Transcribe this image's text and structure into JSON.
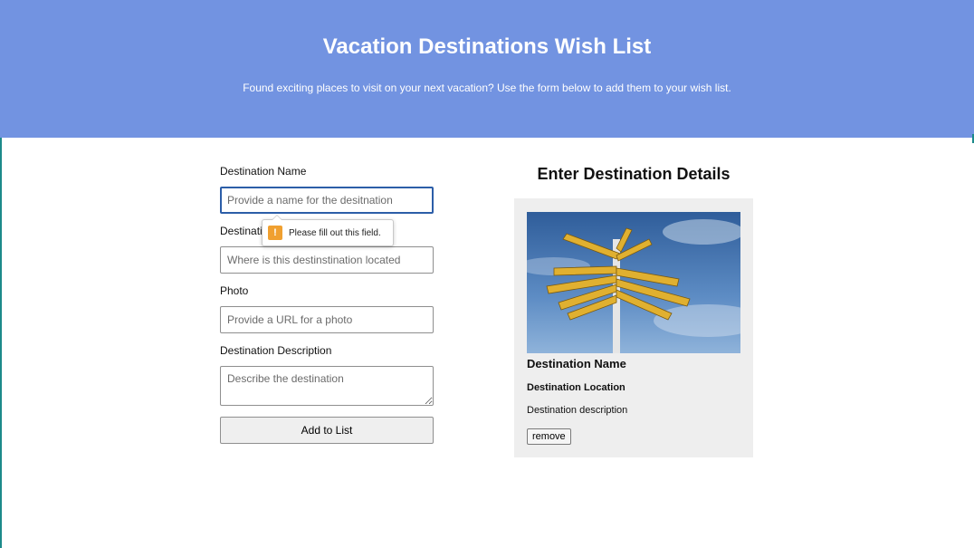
{
  "header": {
    "title": "Vacation Destinations Wish List",
    "subtitle": "Found exciting places to visit on your next vacation? Use the form below to add them to your wish list.",
    "color": "#7293e1"
  },
  "form": {
    "name_label": "Destination Name",
    "name_placeholder": "Provide a name for the desitnation",
    "location_label": "Destination Location",
    "location_placeholder": "Where is this destinstination located",
    "photo_label": "Photo",
    "photo_placeholder": "Provide a URL for a photo",
    "description_label": "Destination Description",
    "description_placeholder": "Describe the destination",
    "submit_label": "Add to List"
  },
  "validation_tooltip": {
    "message": "Please fill out this field.",
    "icon": "warning-icon"
  },
  "preview": {
    "heading": "Enter Destination Details",
    "card": {
      "photo_icon": "signpost-photo",
      "name": "Destination Name",
      "location": "Destination Location",
      "description": "Destination description",
      "remove_label": "remove"
    }
  }
}
